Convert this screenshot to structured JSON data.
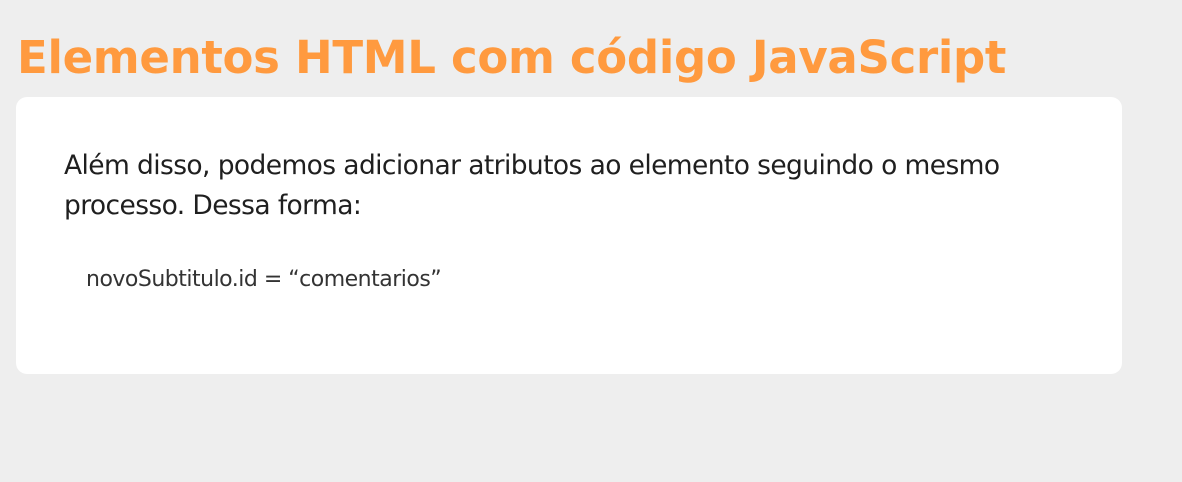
{
  "page": {
    "title": "Elementos HTML com código JavaScript"
  },
  "card": {
    "paragraph": "Além disso, podemos adicionar atributos ao elemento seguindo o mesmo processo. Dessa forma:",
    "code": "novoSubtitulo.id = “comentarios”"
  },
  "colors": {
    "title": "#ff9a3f",
    "background": "#eeeeee",
    "card": "#ffffff",
    "text": "#1f1f1f"
  }
}
